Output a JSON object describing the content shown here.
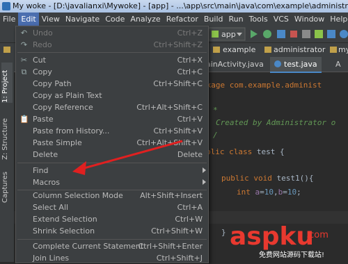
{
  "window": {
    "title": "My woke - [D:\\javalianxi\\Mywoke] - [app] - ...\\app\\src\\main\\java\\com\\example\\administrator\\mywoke"
  },
  "menubar": {
    "items": [
      "File",
      "Edit",
      "View",
      "Navigate",
      "Code",
      "Analyze",
      "Refactor",
      "Build",
      "Run",
      "Tools",
      "VCS",
      "Window",
      "Help"
    ],
    "active": "Edit"
  },
  "toolbar": {
    "run_config": "app"
  },
  "navbar": {
    "crumbs": [
      "example",
      "administrator",
      "mywo"
    ]
  },
  "side_tabs": {
    "project": "1: Project",
    "structure": "Z: Structure",
    "captures": "Captures"
  },
  "editor": {
    "tabs": [
      "ainActivity.java",
      "test.java",
      "A"
    ],
    "lines": {
      "l1a": "ckage com.example.administ",
      "l2": "*",
      "l3": "Created by Administrator o",
      "l4": "/",
      "l5a": "blic class ",
      "l5b": "test {",
      "l6a": "public void ",
      "l6b": "test1(){",
      "l7a": "int ",
      "l7b": "a",
      "l7c": "=",
      "l7d": "10",
      "l7e": ",",
      "l7f": "b",
      "l7g": "=",
      "l7h": "10",
      "l7i": ";",
      "l8": "}"
    }
  },
  "edit_menu": {
    "undo": {
      "label": "Undo",
      "shortcut": "Ctrl+Z"
    },
    "redo": {
      "label": "Redo",
      "shortcut": "Ctrl+Shift+Z"
    },
    "cut": {
      "label": "Cut",
      "shortcut": "Ctrl+X"
    },
    "copy": {
      "label": "Copy",
      "shortcut": "Ctrl+C"
    },
    "copy_path": {
      "label": "Copy Path",
      "shortcut": "Ctrl+Shift+C"
    },
    "copy_plain": {
      "label": "Copy as Plain Text",
      "shortcut": ""
    },
    "copy_ref": {
      "label": "Copy Reference",
      "shortcut": "Ctrl+Alt+Shift+C"
    },
    "paste": {
      "label": "Paste",
      "shortcut": "Ctrl+V"
    },
    "paste_history": {
      "label": "Paste from History...",
      "shortcut": "Ctrl+Shift+V"
    },
    "paste_simple": {
      "label": "Paste Simple",
      "shortcut": "Ctrl+Alt+Shift+V"
    },
    "delete": {
      "label": "Delete",
      "shortcut": "Delete"
    },
    "find": {
      "label": "Find",
      "shortcut": ""
    },
    "macros": {
      "label": "Macros",
      "shortcut": ""
    },
    "column_mode": {
      "label": "Column Selection Mode",
      "shortcut": "Alt+Shift+Insert"
    },
    "select_all": {
      "label": "Select All",
      "shortcut": "Ctrl+A"
    },
    "extend_sel": {
      "label": "Extend Selection",
      "shortcut": "Ctrl+W"
    },
    "shrink_sel": {
      "label": "Shrink Selection",
      "shortcut": "Ctrl+Shift+W"
    },
    "complete_stmt": {
      "label": "Complete Current Statement",
      "shortcut": "Ctrl+Shift+Enter"
    },
    "join_lines": {
      "label": "Join Lines",
      "shortcut": "Ctrl+Shift+J"
    }
  },
  "annotation": {
    "arrow_color": "#e02020"
  },
  "watermark": {
    "brand": "aspku",
    "tld": ".com",
    "slogan": "免费网站源码下载站!"
  }
}
